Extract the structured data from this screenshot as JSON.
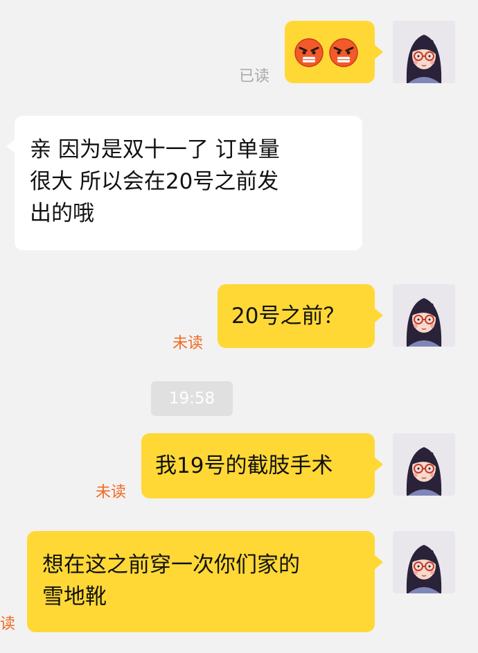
{
  "messages": [
    {
      "side": "right",
      "emoji": [
        "angry-face",
        "angry-face"
      ],
      "status": "已读"
    },
    {
      "side": "left",
      "text_lines": [
        "亲 因为是双十一了  订单量",
        "很大   所以会在20号之前发",
        "出的哦"
      ]
    },
    {
      "side": "right",
      "text": "20号之前？",
      "status": "未读"
    },
    {
      "side": "right",
      "text": "我19号的截肢手术",
      "status": "未读"
    },
    {
      "side": "right",
      "text_lines": [
        "想在这之前穿一次你们家的",
        "雪地靴"
      ],
      "status": "读"
    }
  ],
  "timestamp": "19:58",
  "colors": {
    "self_bubble": "#ffd836",
    "other_bubble": "#ffffff",
    "unread": "#f06a22",
    "read": "#a9a9a9",
    "background": "#f2f2f2"
  }
}
